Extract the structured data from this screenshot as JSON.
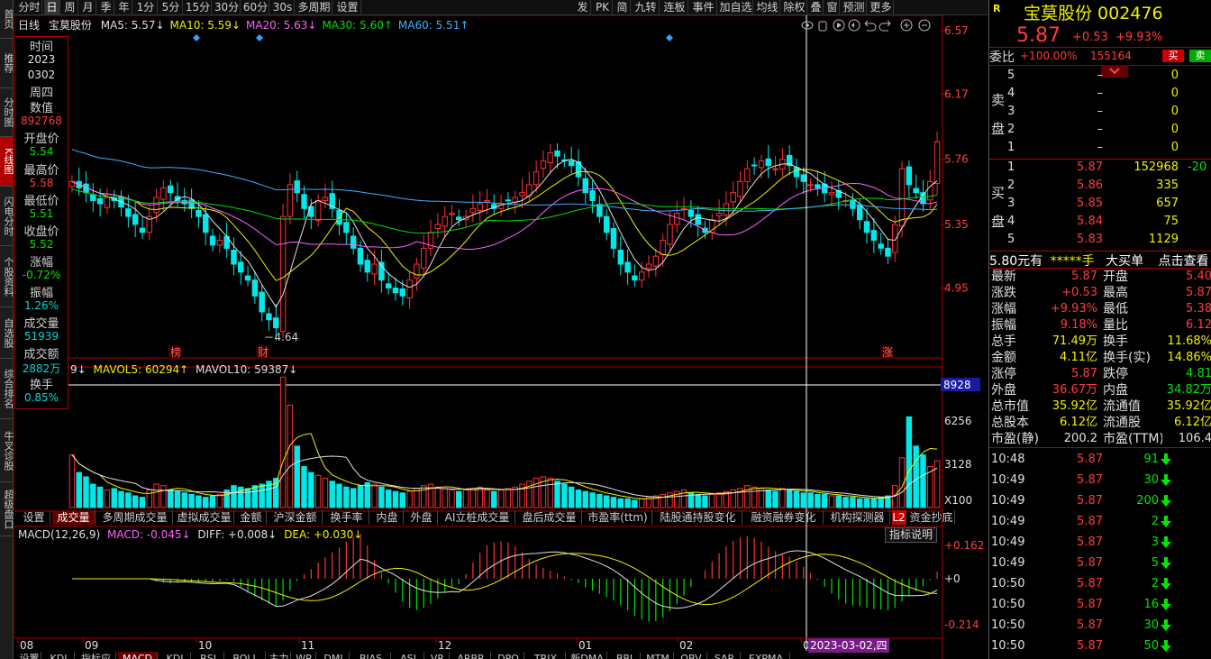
{
  "left_nav": [
    {
      "label": "首页"
    },
    {
      "label": "推荐"
    },
    {
      "label": "分时图"
    },
    {
      "label": "K线图"
    },
    {
      "label": "闪电分时"
    },
    {
      "label": "个股资料"
    },
    {
      "label": "自选股"
    },
    {
      "label": "综合排名"
    },
    {
      "label": "牛叉诊股"
    },
    {
      "label": "超级盘口"
    }
  ],
  "period_bar": {
    "items": [
      "分时",
      "日",
      "周",
      "月",
      "季",
      "年",
      "1分",
      "5分",
      "15分",
      "30分",
      "60分",
      "30s",
      "多周期",
      "设置"
    ],
    "active": "日",
    "right_items": [
      "发",
      "PK",
      "简",
      "九转",
      "连板",
      "事件",
      "加自选",
      "均线",
      "除权",
      "叠",
      "窗",
      "预测",
      "更多"
    ]
  },
  "legend": {
    "type": "日线",
    "stock": "宝莫股份",
    "ma": [
      {
        "label": "MA5: 5.57↓",
        "color": "#e0e0e0"
      },
      {
        "label": "MA10: 5.59↓",
        "color": "#f0f000"
      },
      {
        "label": "MA20: 5.63↓",
        "color": "#ff60ff"
      },
      {
        "label": "MA30: 5.60↑",
        "color": "#00e000"
      },
      {
        "label": "MA60: 5.51↑",
        "color": "#40b0ff"
      }
    ]
  },
  "info_panel": {
    "time_label": "时间",
    "year": "2023",
    "date": "0302",
    "weekday": "周四",
    "value_label": "数值",
    "value": "892768",
    "open_label": "开盘价",
    "open": "5.54",
    "high_label": "最高价",
    "high": "5.58",
    "low_label": "最低价",
    "low": "5.51",
    "close_label": "收盘价",
    "close": "5.52",
    "change_label": "涨幅",
    "change": "-0.72%",
    "amp_label": "振幅",
    "amp": "1.26%",
    "vol_label": "成交量",
    "vol": "51939",
    "amount_label": "成交额",
    "amount": "2882万",
    "turnover_label": "换手",
    "turnover": "0.85%"
  },
  "price_axis": [
    "6.57",
    "6.17",
    "5.76",
    "5.35",
    "4.95"
  ],
  "low_marker": "4.64",
  "event_markers": [
    "榜",
    "财",
    "涨"
  ],
  "vol_legend": {
    "prefix": "9↓",
    "mavol5": "MAVOL5: 60294↑",
    "mavol10": "MAVOL10: 59387↓"
  },
  "vol_axis": [
    "8928",
    "6256",
    "3128",
    "X100"
  ],
  "indicator_tabs": [
    "设置",
    "成交量",
    "多周期成交量",
    "虚拟成交量",
    "金额",
    "沪深金额",
    "换手率",
    "内盘",
    "外盘",
    "AI立桩成交量",
    "盘后成交量",
    "市盈率(ttm)",
    "陆股通持股变化",
    "融资融券变化",
    "机构探测器",
    "L2",
    "资金抄底"
  ],
  "macd_legend": {
    "name": "MACD(12,26,9)",
    "macd": "MACD: -0.045↓",
    "diff": "DIFF: +0.008↓",
    "dea": "DEA: +0.030↓"
  },
  "macd_axis": [
    "+0.162",
    "+0",
    "-0.214"
  ],
  "indicator_help": "指标说明",
  "x_axis": [
    "08",
    "09",
    "10",
    "11",
    "12",
    "01",
    "02",
    "0"
  ],
  "crosshair_date": "2023-03-02,四",
  "bottom_tabs": [
    "设置",
    "KDJ",
    "指标应标",
    "MACD",
    "KDJ",
    "RSI",
    "BOLL",
    "主力",
    "WR",
    "DMI",
    "BIAS",
    "ASI",
    "VR",
    "ARBR",
    "DPO",
    "TRIX",
    "新DMA",
    "BBI",
    "MTM",
    "OBV",
    "SAR",
    "EXPMA"
  ],
  "stock_header": {
    "flag": "R",
    "name_code": "宝莫股份 002476",
    "price": "5.87",
    "change": "+0.53",
    "change_pct": "+9.93%"
  },
  "order_book": {
    "ratio_label": "委比",
    "ratio": "+100.00%",
    "diff": "155164",
    "buy_btn": "买",
    "sell_btn": "卖",
    "sell_label": [
      "卖",
      "盘"
    ],
    "buy_label": [
      "买",
      "盘"
    ],
    "sells": [
      {
        "level": "5",
        "price": "–",
        "vol": "0"
      },
      {
        "level": "4",
        "price": "–",
        "vol": "0"
      },
      {
        "level": "3",
        "price": "–",
        "vol": "0"
      },
      {
        "level": "2",
        "price": "–",
        "vol": "0"
      },
      {
        "level": "1",
        "price": "–",
        "vol": "0"
      }
    ],
    "buys": [
      {
        "level": "1",
        "price": "5.87",
        "vol": "152968",
        "extra": "-20"
      },
      {
        "level": "2",
        "price": "5.86",
        "vol": "335",
        "extra": ""
      },
      {
        "level": "3",
        "price": "5.85",
        "vol": "657",
        "extra": ""
      },
      {
        "level": "4",
        "price": "5.84",
        "vol": "75",
        "extra": ""
      },
      {
        "level": "5",
        "price": "5.83",
        "vol": "1129",
        "extra": ""
      }
    ]
  },
  "big_order": {
    "left": "5.80元有",
    "mid": "*****手",
    "btn": "大买单",
    "link": "点击查看"
  },
  "stats": [
    {
      "l1": "最新",
      "v1": "5.87",
      "c1": "red",
      "l2": "开盘",
      "v2": "5.40",
      "c2": "red"
    },
    {
      "l1": "涨跌",
      "v1": "+0.53",
      "c1": "red",
      "l2": "最高",
      "v2": "5.87",
      "c2": "red"
    },
    {
      "l1": "涨幅",
      "v1": "+9.93%",
      "c1": "red",
      "l2": "最低",
      "v2": "5.38",
      "c2": "red"
    },
    {
      "l1": "振幅",
      "v1": "9.18%",
      "c1": "red",
      "l2": "量比",
      "v2": "6.12",
      "c2": "red"
    },
    {
      "l1": "总手",
      "v1": "71.49万",
      "c1": "yellow",
      "l2": "换手",
      "v2": "11.68%",
      "c2": "yellow"
    },
    {
      "l1": "金额",
      "v1": "4.11亿",
      "c1": "yellow",
      "l2": "换手(实)",
      "v2": "14.86%",
      "c2": "yellow"
    },
    {
      "l1": "涨停",
      "v1": "5.87",
      "c1": "red",
      "l2": "跌停",
      "v2": "4.81",
      "c2": "green"
    },
    {
      "l1": "外盘",
      "v1": "36.67万",
      "c1": "red",
      "l2": "内盘",
      "v2": "34.82万",
      "c2": "green"
    },
    {
      "l1": "总市值",
      "v1": "35.92亿",
      "c1": "yellow",
      "l2": "流通值",
      "v2": "35.92亿",
      "c2": "yellow"
    },
    {
      "l1": "总股本",
      "v1": "6.12亿",
      "c1": "yellow",
      "l2": "流通股",
      "v2": "6.12亿",
      "c2": "yellow"
    },
    {
      "l1": "市盈(静)",
      "v1": "200.2",
      "c1": "white",
      "l2": "市盈(TTM)",
      "v2": "106.4",
      "c2": "white"
    }
  ],
  "ticks": [
    {
      "time": "10:48",
      "price": "5.87",
      "vol": "91",
      "dir": "down"
    },
    {
      "time": "10:49",
      "price": "5.87",
      "vol": "30",
      "dir": "down"
    },
    {
      "time": "10:49",
      "price": "5.87",
      "vol": "200",
      "dir": "down"
    },
    {
      "time": "10:49",
      "price": "5.87",
      "vol": "2",
      "dir": "down"
    },
    {
      "time": "10:49",
      "price": "5.87",
      "vol": "3",
      "dir": "down"
    },
    {
      "time": "10:49",
      "price": "5.87",
      "vol": "5",
      "dir": "down"
    },
    {
      "time": "10:50",
      "price": "5.87",
      "vol": "2",
      "dir": "down"
    },
    {
      "time": "10:50",
      "price": "5.87",
      "vol": "16",
      "dir": "down"
    },
    {
      "time": "10:50",
      "price": "5.87",
      "vol": "30",
      "dir": "down"
    },
    {
      "time": "10:50",
      "price": "5.87",
      "vol": "50",
      "dir": "down"
    }
  ],
  "chart_data": {
    "type": "candlestick",
    "ylim": [
      4.55,
      6.62
    ],
    "x_labels": [
      "08",
      "09",
      "10",
      "11",
      "12",
      "01",
      "02"
    ],
    "closes": [
      5.62,
      5.58,
      5.55,
      5.5,
      5.48,
      5.52,
      5.5,
      5.46,
      5.4,
      5.35,
      5.3,
      5.4,
      5.52,
      5.58,
      5.55,
      5.5,
      5.48,
      5.45,
      5.4,
      5.3,
      5.22,
      5.25,
      5.2,
      5.1,
      5.05,
      5.0,
      4.9,
      4.8,
      4.75,
      4.7,
      5.4,
      5.6,
      5.55,
      5.45,
      5.4,
      5.5,
      5.52,
      5.45,
      5.35,
      5.3,
      5.2,
      5.1,
      5.05,
      5.1,
      5.0,
      4.95,
      4.92,
      4.9,
      5.0,
      5.1,
      5.2,
      5.3,
      5.35,
      5.4,
      5.42,
      5.38,
      5.4,
      5.45,
      5.48,
      5.5,
      5.45,
      5.48,
      5.5,
      5.52,
      5.55,
      5.6,
      5.68,
      5.75,
      5.8,
      5.78,
      5.75,
      5.72,
      5.65,
      5.55,
      5.5,
      5.4,
      5.3,
      5.2,
      5.1,
      5.05,
      5.0,
      5.05,
      5.1,
      5.15,
      5.25,
      5.35,
      5.42,
      5.45,
      5.4,
      5.35,
      5.3,
      5.38,
      5.42,
      5.48,
      5.55,
      5.62,
      5.7,
      5.72,
      5.75,
      5.72,
      5.7,
      5.76,
      5.72,
      5.65,
      5.62,
      5.6,
      5.58,
      5.55,
      5.55,
      5.52,
      5.5,
      5.45,
      5.38,
      5.3,
      5.25,
      5.2,
      5.15,
      5.35,
      5.7,
      5.6,
      5.55,
      5.48,
      5.62,
      5.87
    ],
    "volumes": [
      360,
      240,
      210,
      160,
      140,
      120,
      130,
      110,
      100,
      80,
      70,
      120,
      160,
      150,
      120,
      110,
      100,
      90,
      80,
      70,
      80,
      90,
      120,
      150,
      140,
      130,
      150,
      160,
      180,
      200,
      892,
      700,
      420,
      280,
      240,
      220,
      200,
      180,
      160,
      140,
      130,
      150,
      170,
      160,
      140,
      120,
      110,
      100,
      110,
      130,
      150,
      160,
      140,
      130,
      120,
      110,
      120,
      130,
      140,
      120,
      110,
      120,
      130,
      140,
      160,
      180,
      200,
      210,
      200,
      180,
      160,
      140,
      120,
      110,
      100,
      90,
      80,
      70,
      60,
      60,
      50,
      60,
      70,
      80,
      90,
      100,
      110,
      120,
      100,
      90,
      80,
      90,
      100,
      110,
      120,
      130,
      150,
      140,
      130,
      120,
      110,
      130,
      120,
      110,
      100,
      100,
      90,
      90,
      80,
      80,
      70,
      70,
      60,
      60,
      60,
      70,
      80,
      150,
      340,
      620,
      420,
      360,
      280,
      320,
      720
    ]
  }
}
